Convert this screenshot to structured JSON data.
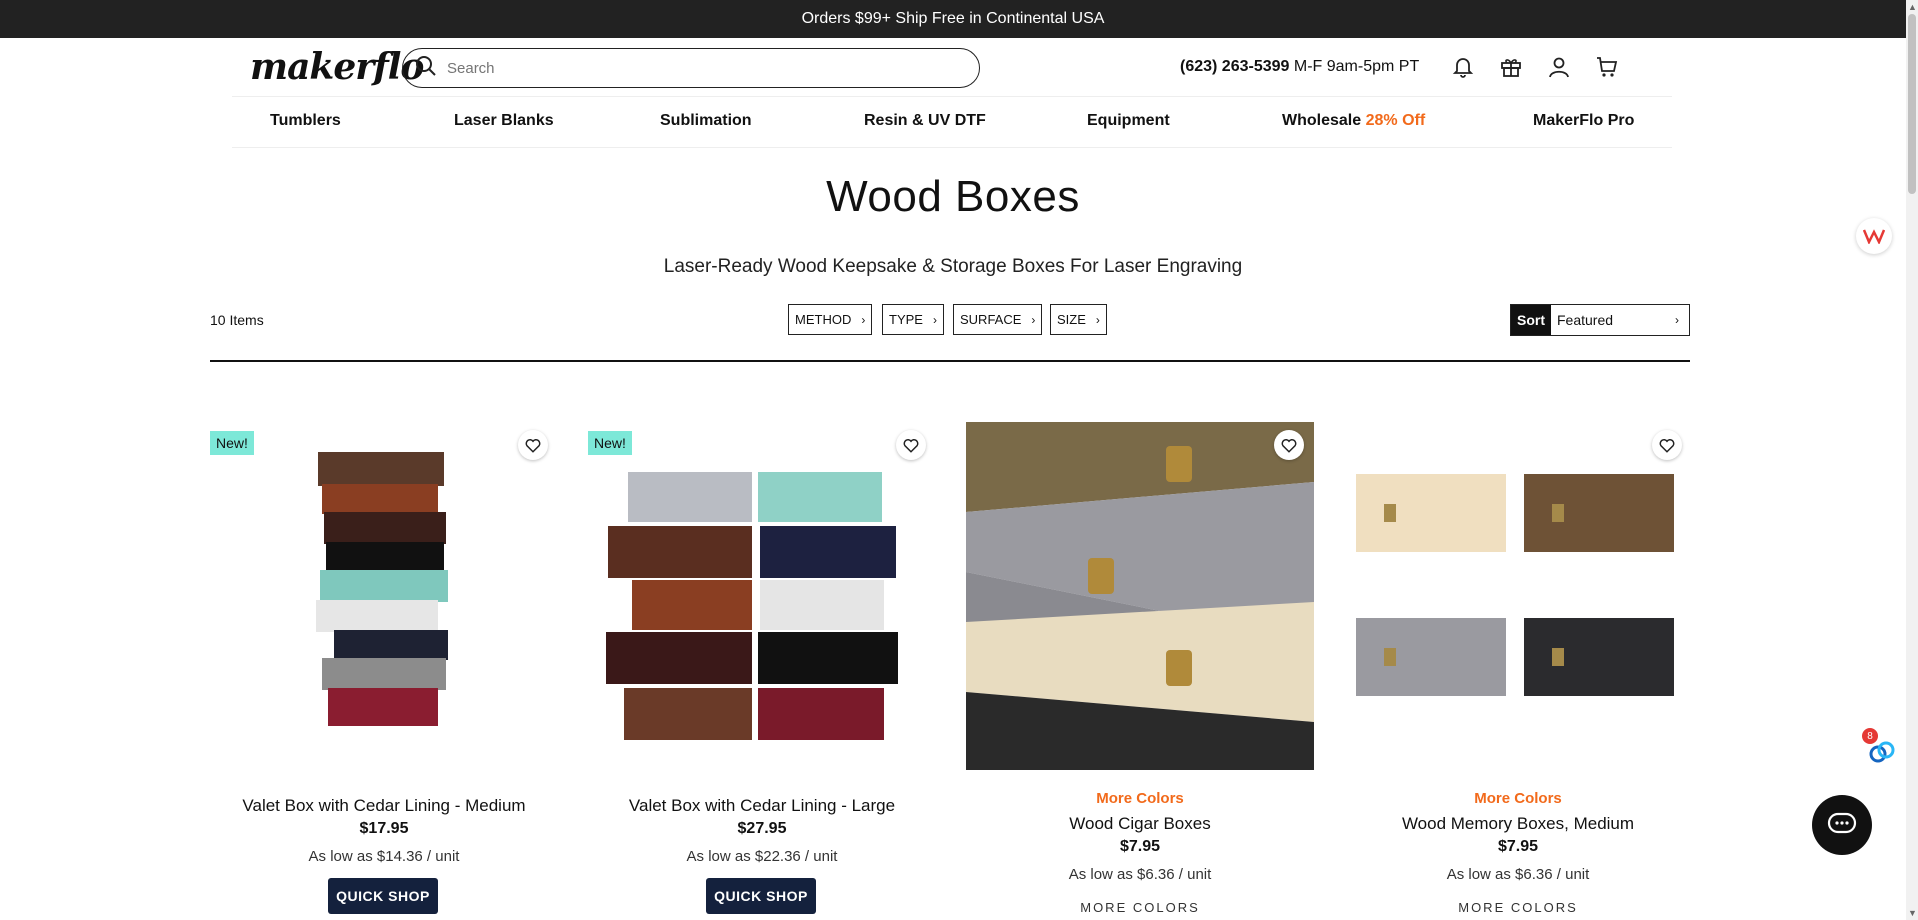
{
  "announcement": "Orders $99+ Ship Free in Continental USA",
  "logo": "makerflo",
  "search": {
    "placeholder": "Search"
  },
  "contact": {
    "phone": "(623) 263-5399",
    "hours": "M-F 9am-5pm PT"
  },
  "header_icons": [
    "bell-icon",
    "gift-icon",
    "account-icon",
    "cart-icon"
  ],
  "nav": [
    {
      "label": "Tumblers"
    },
    {
      "label": "Laser Blanks"
    },
    {
      "label": "Sublimation"
    },
    {
      "label": "Resin & UV DTF"
    },
    {
      "label": "Equipment"
    },
    {
      "label": "Wholesale",
      "accent": "28% Off"
    },
    {
      "label": "MakerFlo Pro"
    }
  ],
  "page": {
    "title": "Wood Boxes",
    "subtitle": "Laser-Ready Wood Keepsake & Storage Boxes For Laser Engraving",
    "items_count": "10 Items"
  },
  "filters": [
    "METHOD",
    "TYPE",
    "SURFACE",
    "SIZE"
  ],
  "sort": {
    "label": "Sort",
    "value": "Featured"
  },
  "products": [
    {
      "badge": "New!",
      "name": "Valet Box with Cedar Lining - Medium",
      "price": "$17.95",
      "as_low_as": "As low as $14.36 / unit",
      "button": "QUICK SHOP"
    },
    {
      "badge": "New!",
      "name": "Valet Box with Cedar Lining - Large",
      "price": "$27.95",
      "as_low_as": "As low as $22.36 / unit",
      "button": "QUICK SHOP"
    },
    {
      "colors_tag": "More Colors",
      "name": "Wood Cigar Boxes",
      "price": "$7.95",
      "as_low_as": "As low as $6.36 / unit",
      "link": "MORE COLORS"
    },
    {
      "colors_tag": "More Colors",
      "name": "Wood Memory Boxes, Medium",
      "price": "$7.95",
      "as_low_as": "As low as $6.36 / unit",
      "link": "MORE COLORS"
    }
  ],
  "widget": {
    "count": "8"
  },
  "colors": {
    "accent": "#f26a1b",
    "topbar": "#222222",
    "new_badge": "#7de8d8",
    "button": "#14213d"
  }
}
